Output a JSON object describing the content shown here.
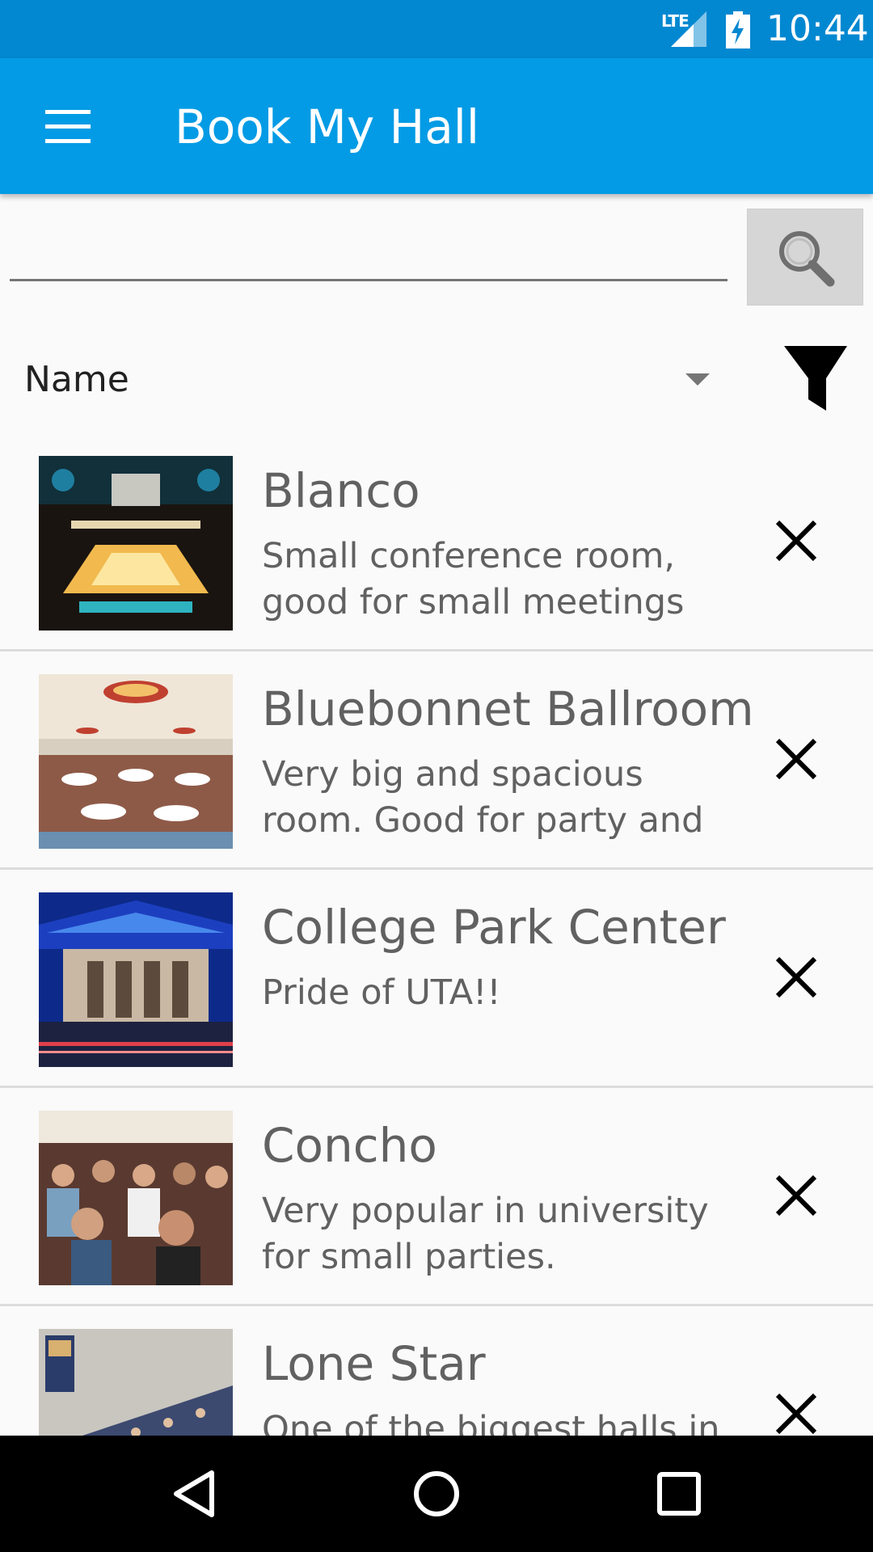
{
  "status_bar": {
    "network": "LTE",
    "time": "10:44",
    "icons": [
      "signal-icon",
      "battery-charging-icon"
    ]
  },
  "app_bar": {
    "title": "Book My Hall",
    "menu_icon": "menu-icon"
  },
  "search": {
    "value": "",
    "placeholder": "",
    "button_icon": "search-icon"
  },
  "sort": {
    "selected": "Name",
    "filter_icon": "filter-icon"
  },
  "halls": [
    {
      "name": "Blanco",
      "description": "Small conference room, good for small meetings",
      "thumb": "banquet-room-photo"
    },
    {
      "name": "Bluebonnet Ballroom",
      "description": "Very big and spacious room. Good for party and",
      "thumb": "ballroom-photo"
    },
    {
      "name": "College Park Center",
      "description": "Pride of UTA!!",
      "thumb": "arena-exterior-photo"
    },
    {
      "name": "Concho",
      "description": "Very popular in university for small parties.",
      "thumb": "audience-photo"
    },
    {
      "name": "Lone Star",
      "description": "One of the biggest halls in",
      "thumb": "lecture-hall-photo"
    }
  ],
  "nav_bar": {
    "back_icon": "back-icon",
    "home_icon": "home-icon",
    "recents_icon": "recents-icon"
  },
  "colors": {
    "status_bar": "#0288d1",
    "app_bar": "#039be5",
    "background": "#fafafa",
    "text_secondary": "#616161"
  }
}
